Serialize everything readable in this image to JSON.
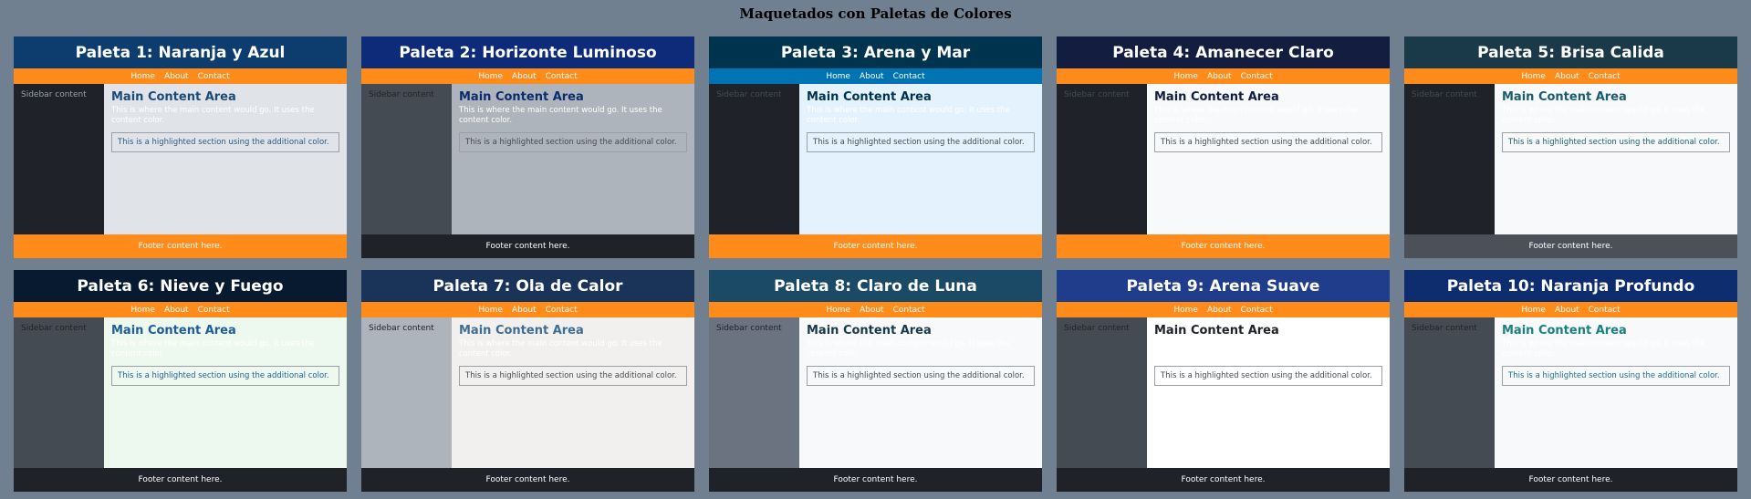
{
  "page": {
    "title": "Maquetados con Paletas de Colores"
  },
  "nav": [
    "Home",
    "About",
    "Contact"
  ],
  "sidebar_text": "Sidebar content",
  "main_title": "Main Content Area",
  "main_text": "This is where the main content would go. It uses the content color.",
  "highlight_text": "This is a highlighted section using the additional color.",
  "footer_text": "Footer content here.",
  "palettes": [
    {
      "title": "Paleta 1: Naranja y Azul",
      "colors": {
        "header": "#0d3c6e",
        "nav": "#ff8c1a",
        "sidebar": "#1f2329",
        "sidebar_text": "#9aa0a6",
        "main": "#e0e3e8",
        "main_title": "#1a4c7a",
        "main_text": "#ffffff",
        "highlight_text": "#2a5a86",
        "footer": "#ff8c1a"
      }
    },
    {
      "title": "Paleta 2: Horizonte Luminoso",
      "colors": {
        "header": "#0d2b78",
        "nav": "#ff8c1a",
        "sidebar": "#454b52",
        "sidebar_text": "#1f2329",
        "main": "#adb4bb",
        "main_title": "#0d2b6e",
        "main_text": "#ffffff",
        "highlight_text": "#454b52",
        "footer": "#1f2329"
      }
    },
    {
      "title": "Paleta 3: Arena y Mar",
      "colors": {
        "header": "#00334d",
        "nav": "#0074b3",
        "sidebar": "#1f2329",
        "sidebar_text": "#454b52",
        "main": "#e3f2fd",
        "main_title": "#00334d",
        "main_text": "#ffffff",
        "highlight_text": "#454b52",
        "footer": "#ff8c1a"
      }
    },
    {
      "title": "Paleta 4: Amanecer Claro",
      "colors": {
        "header": "#131d3f",
        "nav": "#ff8c1a",
        "sidebar": "#1f2329",
        "sidebar_text": "#454b52",
        "main": "#f7f9fb",
        "main_title": "#131d3f",
        "main_text": "#ffffff",
        "highlight_text": "#454b52",
        "footer": "#ff8c1a"
      }
    },
    {
      "title": "Paleta 5: Brisa Calida",
      "colors": {
        "header": "#1a3a4a",
        "nav": "#ff8c1a",
        "sidebar": "#1f2329",
        "sidebar_text": "#454b52",
        "main": "#f7f9fb",
        "main_title": "#1a5d6e",
        "main_text": "#ffffff",
        "highlight_text": "#1a5d6e",
        "footer": "#4b5159"
      }
    },
    {
      "title": "Paleta 6: Nieve y Fuego",
      "colors": {
        "header": "#071a30",
        "nav": "#ff8c1a",
        "sidebar": "#454b52",
        "sidebar_text": "#1f2329",
        "main": "#edf8ee",
        "main_title": "#1f5e9a",
        "main_text": "#ffffff",
        "highlight_text": "#1f5e9a",
        "footer": "#1f2329"
      }
    },
    {
      "title": "Paleta 7: Ola de Calor",
      "colors": {
        "header": "#1a3358",
        "nav": "#ff8c1a",
        "sidebar": "#adb4bb",
        "sidebar_text": "#1f2329",
        "main": "#f2f0ee",
        "main_title": "#3e6d95",
        "main_text": "#ffffff",
        "highlight_text": "#454b52",
        "footer": "#1f2329"
      }
    },
    {
      "title": "Paleta 8: Claro de Luna",
      "colors": {
        "header": "#1a4a66",
        "nav": "#ff8c1a",
        "sidebar": "#6b7380",
        "sidebar_text": "#1f2329",
        "main": "#f7f9fb",
        "main_title": "#1a3a4a",
        "main_text": "#ffffff",
        "highlight_text": "#454b52",
        "footer": "#1f2329"
      }
    },
    {
      "title": "Paleta 9: Arena Suave",
      "colors": {
        "header": "#1f3d8a",
        "nav": "#ff8c1a",
        "sidebar": "#454b52",
        "sidebar_text": "#1f2329",
        "main": "#ffffff",
        "main_title": "#1f2329",
        "main_text": "#ffffff",
        "highlight_text": "#454b52",
        "footer": "#1f2329"
      }
    },
    {
      "title": "Paleta 10: Naranja Profundo",
      "colors": {
        "header": "#0d2d6e",
        "nav": "#ff8c1a",
        "sidebar": "#454b52",
        "sidebar_text": "#1f2329",
        "main": "#f7f9fb",
        "main_title": "#1a8080",
        "main_text": "#ffffff",
        "highlight_text": "#1a6e8a",
        "footer": "#1f2329"
      }
    }
  ]
}
